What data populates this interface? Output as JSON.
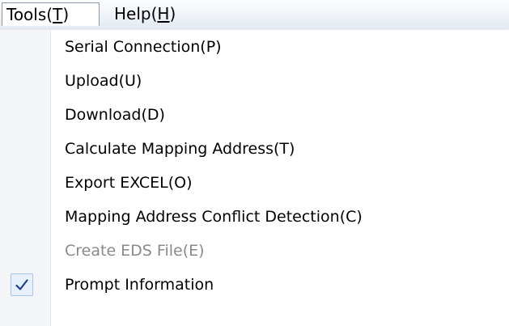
{
  "menubar": {
    "tools": {
      "label": "Tools",
      "accelerator": "T"
    },
    "help": {
      "label": "Help",
      "accelerator": "H"
    }
  },
  "tools_menu": {
    "items": [
      {
        "label": "Serial Connection(P)",
        "enabled": true,
        "checked": false
      },
      {
        "label": "Upload(U)",
        "enabled": true,
        "checked": false
      },
      {
        "label": "Download(D)",
        "enabled": true,
        "checked": false
      },
      {
        "label": "Calculate Mapping Address(T)",
        "enabled": true,
        "checked": false
      },
      {
        "label": "Export EXCEL(O)",
        "enabled": true,
        "checked": false
      },
      {
        "label": "Mapping Address Conflict Detection(C)",
        "enabled": true,
        "checked": false
      },
      {
        "label": "Create EDS File(E)",
        "enabled": false,
        "checked": false
      },
      {
        "label": "Prompt Information",
        "enabled": true,
        "checked": true
      }
    ]
  },
  "colors": {
    "disabled_text": "#8a8a8a",
    "check_color": "#1f3f8f"
  },
  "icons": {
    "check": "checkmark-icon"
  }
}
